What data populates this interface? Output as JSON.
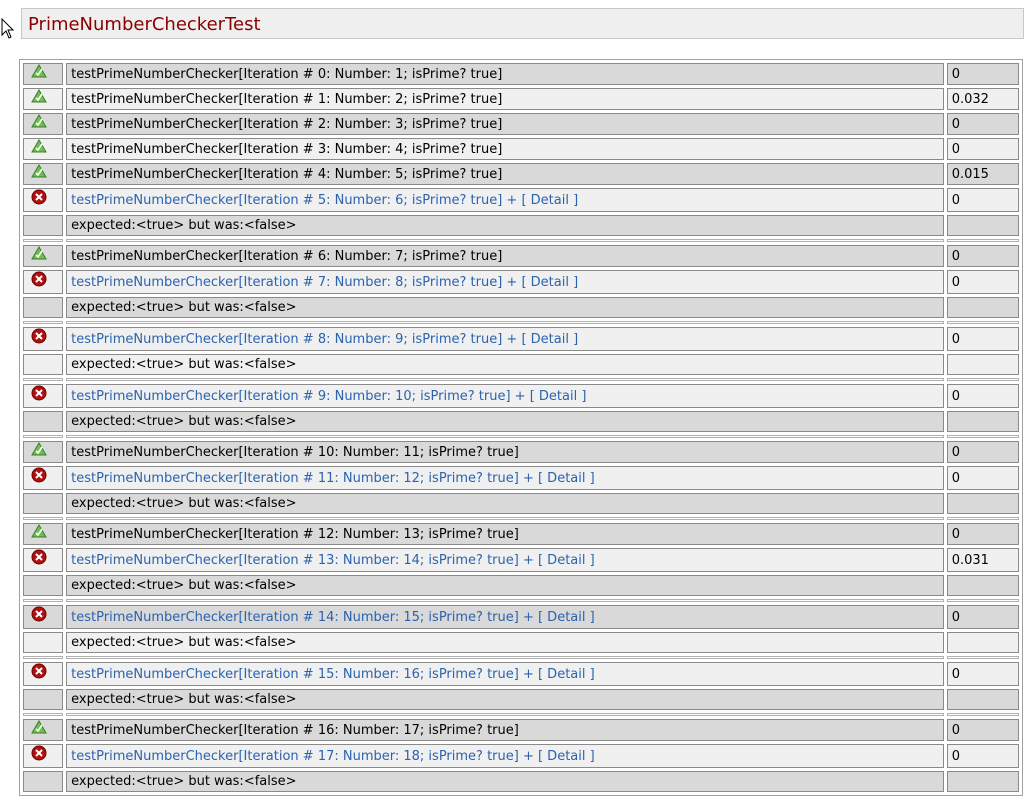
{
  "title": "PrimeNumberCheckerTest",
  "rows": [
    {
      "type": "pass",
      "name": "testPrimeNumberChecker[Iteration # 0: Number: 1; isPrime? true]",
      "time": "0",
      "shade": "dark"
    },
    {
      "type": "pass",
      "name": "testPrimeNumberChecker[Iteration # 1: Number: 2; isPrime? true]",
      "time": "0.032",
      "shade": "light"
    },
    {
      "type": "pass",
      "name": "testPrimeNumberChecker[Iteration # 2: Number: 3; isPrime? true]",
      "time": "0",
      "shade": "dark"
    },
    {
      "type": "pass",
      "name": "testPrimeNumberChecker[Iteration # 3: Number: 4; isPrime? true]",
      "time": "0",
      "shade": "light"
    },
    {
      "type": "pass",
      "name": "testPrimeNumberChecker[Iteration # 4: Number: 5; isPrime? true]",
      "time": "0.015",
      "shade": "dark"
    },
    {
      "type": "fail",
      "name": "testPrimeNumberChecker[Iteration # 5: Number: 6; isPrime? true] + [ Detail ]",
      "time": "0",
      "shade": "light"
    },
    {
      "type": "msg",
      "name": "expected:<true> but was:<false>",
      "time": "",
      "shade": "dark"
    },
    {
      "type": "sep"
    },
    {
      "type": "pass",
      "name": "testPrimeNumberChecker[Iteration # 6: Number: 7; isPrime? true]",
      "time": "0",
      "shade": "dark"
    },
    {
      "type": "fail",
      "name": "testPrimeNumberChecker[Iteration # 7: Number: 8; isPrime? true] + [ Detail ]",
      "time": "0",
      "shade": "light"
    },
    {
      "type": "msg",
      "name": "expected:<true> but was:<false>",
      "time": "",
      "shade": "dark"
    },
    {
      "type": "sep"
    },
    {
      "type": "fail",
      "name": "testPrimeNumberChecker[Iteration # 8: Number: 9; isPrime? true] + [ Detail ]",
      "time": "0",
      "shade": "light"
    },
    {
      "type": "msg",
      "name": "expected:<true> but was:<false>",
      "time": "",
      "shade": "light"
    },
    {
      "type": "sep"
    },
    {
      "type": "fail",
      "name": "testPrimeNumberChecker[Iteration # 9: Number: 10; isPrime? true] + [ Detail ]",
      "time": "0",
      "shade": "light"
    },
    {
      "type": "msg",
      "name": "expected:<true> but was:<false>",
      "time": "",
      "shade": "dark"
    },
    {
      "type": "sep"
    },
    {
      "type": "pass",
      "name": "testPrimeNumberChecker[Iteration # 10: Number: 11; isPrime? true]",
      "time": "0",
      "shade": "dark"
    },
    {
      "type": "fail",
      "name": "testPrimeNumberChecker[Iteration # 11: Number: 12; isPrime? true] + [ Detail ]",
      "time": "0",
      "shade": "light"
    },
    {
      "type": "msg",
      "name": "expected:<true> but was:<false>",
      "time": "",
      "shade": "dark"
    },
    {
      "type": "sep"
    },
    {
      "type": "pass",
      "name": "testPrimeNumberChecker[Iteration # 12: Number: 13; isPrime? true]",
      "time": "0",
      "shade": "dark"
    },
    {
      "type": "fail",
      "name": "testPrimeNumberChecker[Iteration # 13: Number: 14; isPrime? true] + [ Detail ]",
      "time": "0.031",
      "shade": "light"
    },
    {
      "type": "msg",
      "name": "expected:<true> but was:<false>",
      "time": "",
      "shade": "dark"
    },
    {
      "type": "sep"
    },
    {
      "type": "fail",
      "name": "testPrimeNumberChecker[Iteration # 14: Number: 15; isPrime? true] + [ Detail ]",
      "time": "0",
      "shade": "dark"
    },
    {
      "type": "msg",
      "name": "expected:<true> but was:<false>",
      "time": "",
      "shade": "light"
    },
    {
      "type": "sep"
    },
    {
      "type": "fail",
      "name": "testPrimeNumberChecker[Iteration # 15: Number: 16; isPrime? true] + [ Detail ]",
      "time": "0",
      "shade": "light"
    },
    {
      "type": "msg",
      "name": "expected:<true> but was:<false>",
      "time": "",
      "shade": "dark"
    },
    {
      "type": "sep"
    },
    {
      "type": "pass",
      "name": "testPrimeNumberChecker[Iteration # 16: Number: 17; isPrime? true]",
      "time": "0",
      "shade": "dark"
    },
    {
      "type": "fail",
      "name": "testPrimeNumberChecker[Iteration # 17: Number: 18; isPrime? true] + [ Detail ]",
      "time": "0",
      "shade": "light"
    },
    {
      "type": "msg",
      "name": "expected:<true> but was:<false>",
      "time": "",
      "shade": "dark"
    }
  ],
  "colors": {
    "title": "#8b0000",
    "link": "#2b63ae",
    "pass_icon": "#4a9e3a",
    "fail_icon": "#b01010"
  },
  "icons": {
    "pass": "pass-icon",
    "fail": "fail-icon",
    "cursor": "mouse-cursor-icon"
  }
}
